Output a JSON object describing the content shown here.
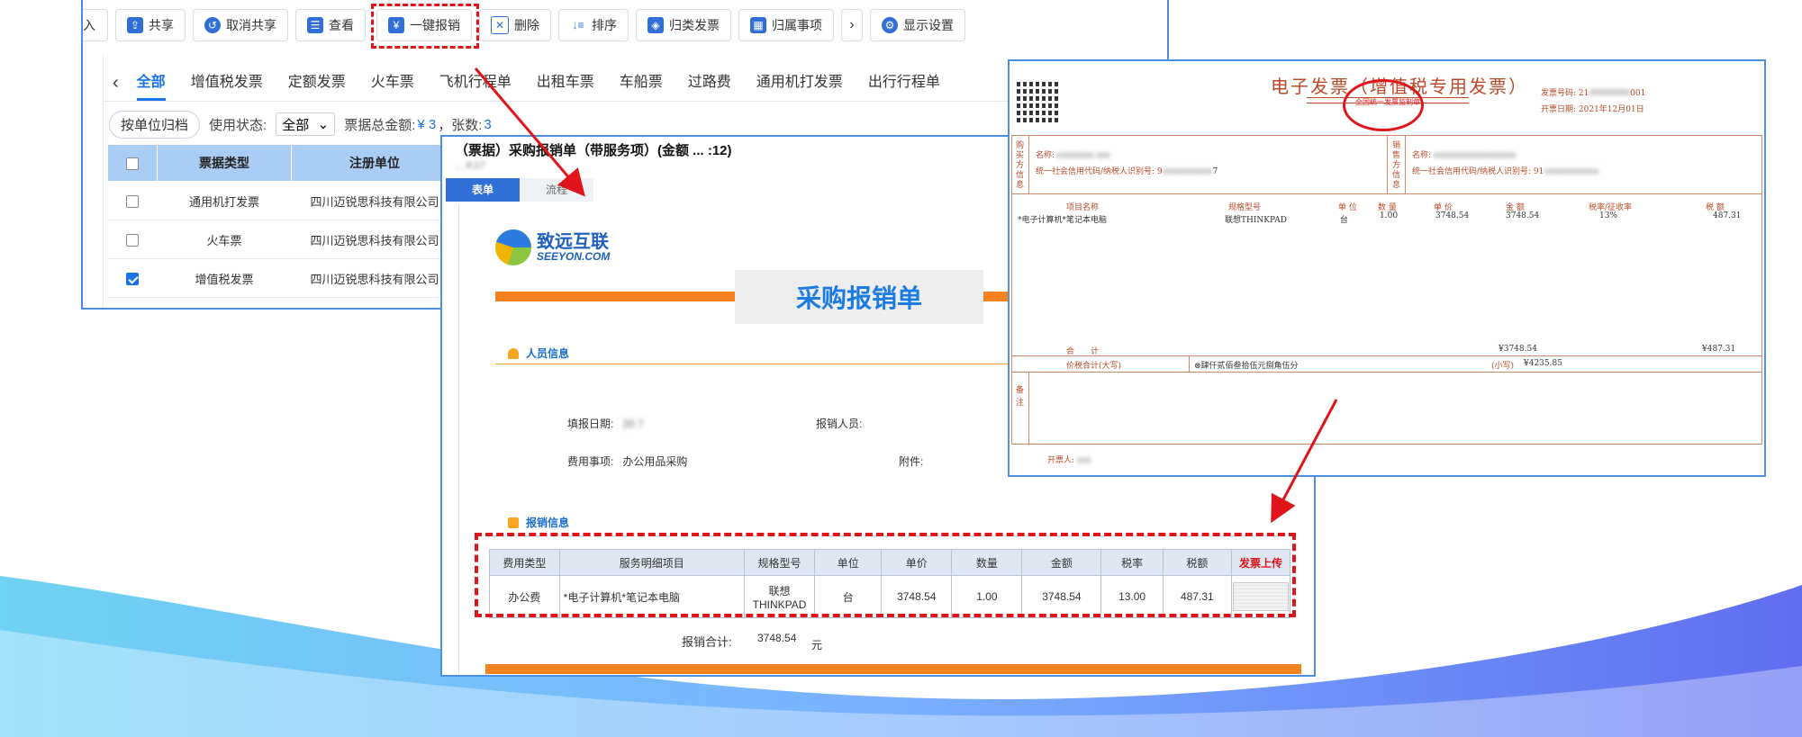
{
  "toolbar": {
    "buttons": [
      {
        "label": "入",
        "icon": "import-icon"
      },
      {
        "label": "共享",
        "icon": "share-icon"
      },
      {
        "label": "取消共享",
        "icon": "unshare-icon"
      },
      {
        "label": "查看",
        "icon": "view-icon"
      },
      {
        "label": "一键报销",
        "icon": "reimburse-icon"
      },
      {
        "label": "删除",
        "icon": "trash-icon"
      },
      {
        "label": "排序",
        "icon": "sort-icon"
      },
      {
        "label": "归类发票",
        "icon": "layers-icon"
      },
      {
        "label": "归属事项",
        "icon": "grid-icon"
      },
      {
        "label": "显示设置",
        "icon": "gear-icon"
      }
    ]
  },
  "tabs": [
    "全部",
    "增值税发票",
    "定额发票",
    "火车票",
    "飞机行程单",
    "出租车票",
    "车船票",
    "过路费",
    "通用机打发票",
    "出行行程单"
  ],
  "filters": {
    "archive_btn": "按单位归档",
    "status_label": "使用状态:",
    "status_value": "全部",
    "total_label": "票据总金额:",
    "total_value": "¥  3",
    "count_label": "，张数:",
    "count_value": "3"
  },
  "invoice_table": {
    "headers": [
      "票据类型",
      "注册单位"
    ],
    "rows": [
      {
        "type": "通用机打发票",
        "unit": "四川迈锐思科技有限公司",
        "checked": false
      },
      {
        "type": "火车票",
        "unit": "四川迈锐思科技有限公司",
        "checked": false
      },
      {
        "type": "增值税发票",
        "unit": "四川迈锐思科技有限公司",
        "checked": true
      }
    ]
  },
  "form": {
    "title": "（票据）采购报销单（带服务项）(金额 ... :12)",
    "subtitle": "... 4:17",
    "tabs": [
      "表单",
      "流程"
    ],
    "logo_cn": "致远互联",
    "logo_en": "SEEYON.COM",
    "heading": "采购报销单",
    "section_person": "人员信息",
    "fill_date_label": "填报日期:",
    "fill_date_value": "20   7",
    "reporter_label": "报销人员:",
    "reporter_value": "  ",
    "expense_item_label": "费用事项:",
    "expense_item_value": "办公用品采购",
    "attachment_label": "附件:",
    "section_reimburse": "报销信息",
    "table_headers": [
      "费用类型",
      "服务明细项目",
      "规格型号",
      "单位",
      "单价",
      "数量",
      "金额",
      "税率",
      "税额",
      "发票上传"
    ],
    "table_row": [
      "办公费",
      "*电子计算机*笔记本电脑",
      "联想 THINKPAD",
      "台",
      "3748.54",
      "1.00",
      "3748.54",
      "13.00",
      "487.31"
    ],
    "total_label": "报销合计:",
    "total_value": "3748.54",
    "total_unit": "元"
  },
  "einvoice": {
    "title": "电子发票（增值税专用发票）",
    "invoice_no_label": "发票号码: 21",
    "invoice_no_tail": "001",
    "date_label": "开票日期: 2021年12月01日",
    "seal_text": "全国统一发票监制章",
    "buyer_side": "购买方信息",
    "seller_side": "销售方信息",
    "buyer_name_label": "名称:",
    "buyer_tax_label": "统一社会信用代码/纳税人识别号: 9",
    "buyer_tax_tail": "7",
    "seller_name_label": "名称:",
    "seller_tax_label": "统一社会信用代码/纳税人识别号: 91",
    "cols": [
      "项目名称",
      "规格型号",
      "单 位",
      "数 量",
      "单 价",
      "金 额",
      "税率/征收率",
      "税 额"
    ],
    "item": [
      "*电子计算机*笔记本电脑",
      "联想THINKPAD",
      "台",
      "1.00",
      "3748.54",
      "3748.54",
      "13%",
      "487.31"
    ],
    "sum_label": "合　　计",
    "sum_amount": "¥3748.54",
    "sum_tax": "¥487.31",
    "total_cn_label": "价税合计(大写)",
    "total_cn_value": "⊗肆仟贰佰叁拾伍元捌角伍分",
    "total_small_label": "(小写)",
    "total_small_value": "¥4235.85",
    "remark_label": "备注",
    "issuer_label": "开票人:"
  },
  "colors": {
    "accent": "#1a73e8",
    "highlight": "#e0151b",
    "orange": "#f5821f",
    "frame": "#4a90e2"
  }
}
